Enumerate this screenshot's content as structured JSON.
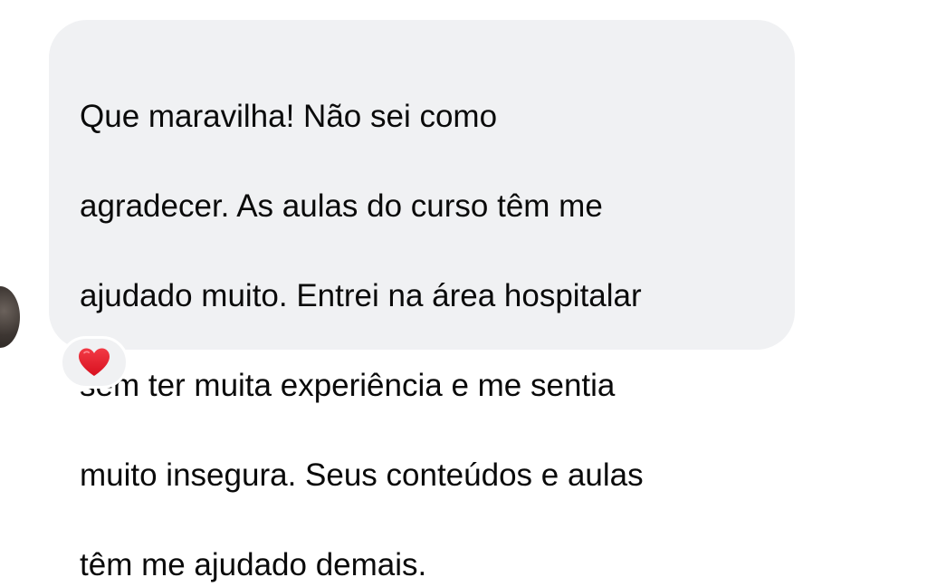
{
  "message": {
    "lines": [
      "Que maravilha! Não sei como",
      "agradecer. As aulas do curso têm me",
      "ajudado muito. Entrei na área hospitalar",
      "sem ter muita experiência e me sentia",
      "muito insegura. Seus conteúdos e aulas",
      "têm me ajudado demais."
    ]
  },
  "reaction": {
    "icon": "red-heart-icon",
    "color": "#e8202f"
  },
  "colors": {
    "bubble": "#f0f1f3",
    "text": "#0a0a0a",
    "background": "#ffffff"
  }
}
